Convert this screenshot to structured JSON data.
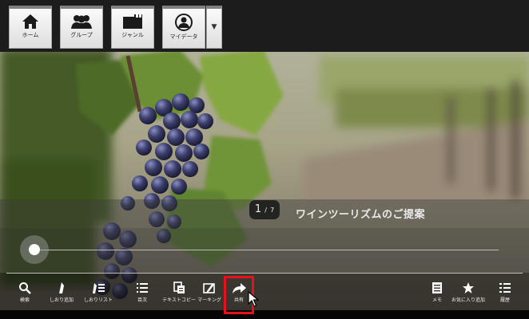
{
  "nav": {
    "items": [
      {
        "label": "ホーム",
        "icon": "home-icon"
      },
      {
        "label": "グループ",
        "icon": "group-icon"
      },
      {
        "label": "ジャンル",
        "icon": "folder-icon"
      },
      {
        "label": "マイデータ",
        "icon": "person-icon"
      }
    ],
    "dropdown_icon": "caret-down-icon"
  },
  "page": {
    "current": "1",
    "separator": "/",
    "total": "7",
    "title": "ワインツーリズムのご提案"
  },
  "slider": {
    "position": 0.0
  },
  "toolbar": {
    "items": [
      {
        "label": "検索",
        "icon": "search-icon"
      },
      {
        "label": "しおり追加",
        "icon": "bookmark-add-icon"
      },
      {
        "label": "しおりリスト",
        "icon": "bookmark-list-icon"
      },
      {
        "label": "目次",
        "icon": "toc-icon"
      },
      {
        "label": "テキストコピー",
        "icon": "text-copy-icon"
      },
      {
        "label": "マーキング",
        "icon": "marking-icon"
      },
      {
        "label": "共有",
        "icon": "share-icon"
      },
      {
        "label": "メモ",
        "icon": "memo-icon"
      },
      {
        "label": "お気に入り追加",
        "icon": "favorite-icon"
      },
      {
        "label": "履歴",
        "icon": "history-icon"
      }
    ]
  },
  "colors": {
    "highlight": "#e8101a",
    "toolbar_text": "#eeeeee"
  }
}
